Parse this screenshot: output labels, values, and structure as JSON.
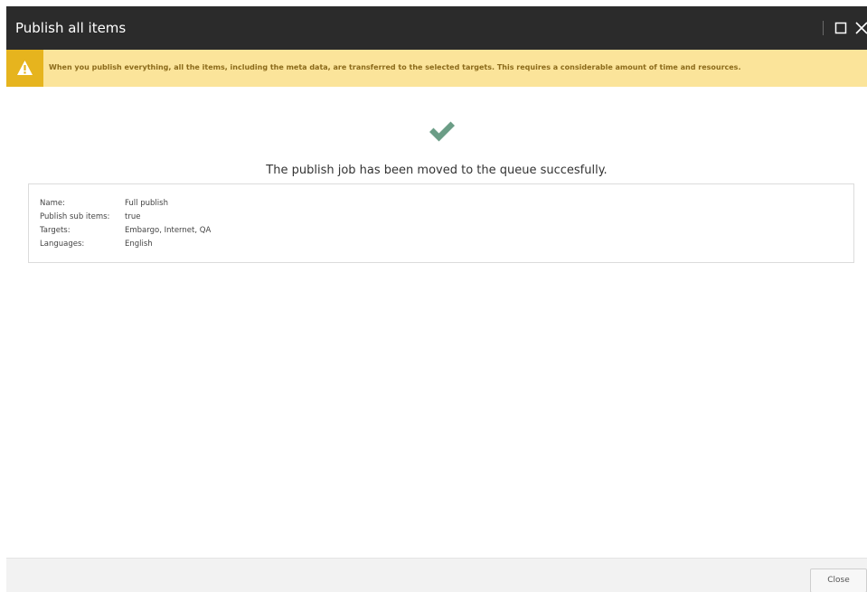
{
  "dialog": {
    "title": "Publish all items",
    "maximize_icon": "maximize-icon",
    "close_icon": "close-icon"
  },
  "warning": {
    "icon": "warning-triangle-icon",
    "text": "When you publish everything, all the items, including the meta data, are transferred to the selected targets. This requires a considerable amount of time and resources."
  },
  "result": {
    "icon": "checkmark-icon",
    "message": "The publish job has been moved to the queue succesfully."
  },
  "details": [
    {
      "label": "Name:",
      "value": "Full publish"
    },
    {
      "label": "Publish sub items:",
      "value": "true"
    },
    {
      "label": "Targets:",
      "value": "Embargo, Internet, QA"
    },
    {
      "label": "Languages:",
      "value": "English"
    }
  ],
  "footer": {
    "close_label": "Close"
  },
  "colors": {
    "titlebar": "#2b2b2b",
    "warning_bg": "#fbe49a",
    "warning_icon_bg": "#e6b41e",
    "check": "#6b9d86"
  }
}
